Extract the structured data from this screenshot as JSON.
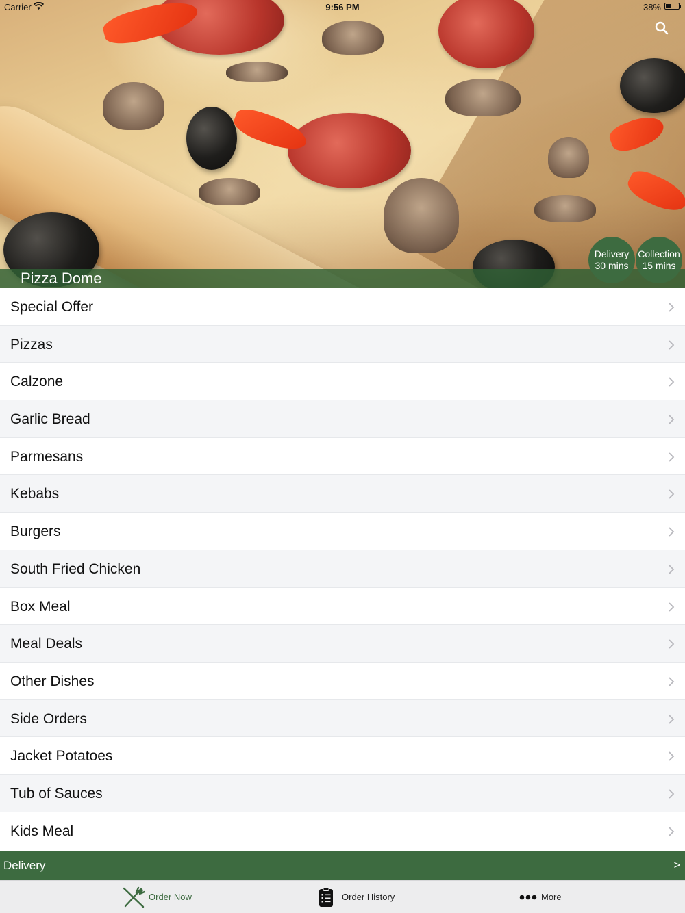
{
  "status_bar": {
    "carrier": "Carrier",
    "time": "9:56 PM",
    "battery_percent": "38%",
    "battery_level": 0.38
  },
  "header": {
    "restaurant_name": "Pizza Dome",
    "delivery_badge": {
      "title": "Delivery",
      "time": "30 mins"
    },
    "collection_badge": {
      "title": "Collection",
      "time": "15 mins"
    },
    "search_icon": "search-icon"
  },
  "menu": {
    "items": [
      {
        "label": "Special Offer"
      },
      {
        "label": "Pizzas"
      },
      {
        "label": "Calzone"
      },
      {
        "label": "Garlic Bread"
      },
      {
        "label": "Parmesans"
      },
      {
        "label": "Kebabs"
      },
      {
        "label": "Burgers"
      },
      {
        "label": "South Fried Chicken"
      },
      {
        "label": "Box Meal"
      },
      {
        "label": "Meal Deals"
      },
      {
        "label": "Other Dishes"
      },
      {
        "label": "Side Orders"
      },
      {
        "label": "Jacket Potatoes"
      },
      {
        "label": "Tub of Sauces"
      },
      {
        "label": "Kids Meal"
      }
    ]
  },
  "order_mode_bar": {
    "label": "Delivery",
    "arrow": ">"
  },
  "tabs": {
    "order_now": {
      "label": "Order Now",
      "icon": "fork-knife-icon"
    },
    "order_history": {
      "label": "Order History",
      "icon": "clipboard-list-icon"
    },
    "more": {
      "label": "More",
      "icon": "more-dots-icon"
    }
  },
  "colors": {
    "brand_green": "#3d6b40",
    "row_alt": "#f4f5f7",
    "chevron": "#b8b8bd"
  }
}
